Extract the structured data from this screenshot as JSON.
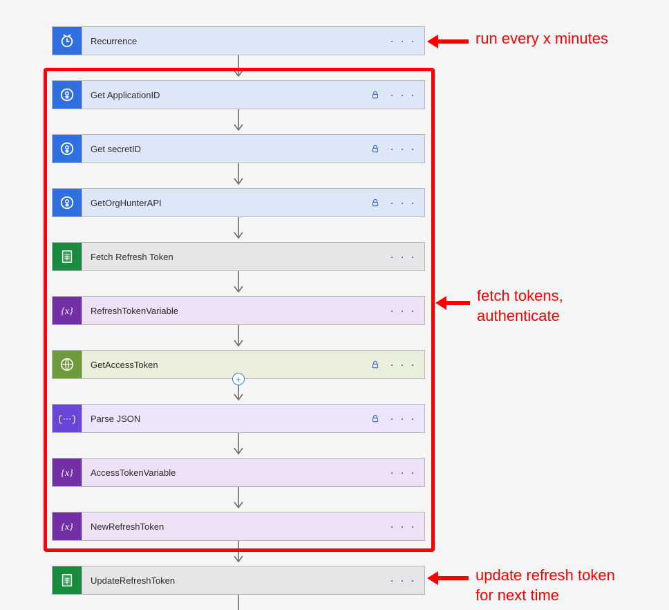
{
  "steps": [
    {
      "title": "Recurrence",
      "lock": false,
      "variant": "blue",
      "icon": "clock"
    },
    {
      "title": "Get ApplicationID",
      "lock": true,
      "variant": "blue",
      "icon": "keyvault"
    },
    {
      "title": "Get secretID",
      "lock": true,
      "variant": "blue",
      "icon": "keyvault"
    },
    {
      "title": "GetOrgHunterAPI",
      "lock": true,
      "variant": "blue",
      "icon": "keyvault"
    },
    {
      "title": "Fetch Refresh Token",
      "lock": false,
      "variant": "green-sheet",
      "icon": "sheet"
    },
    {
      "title": "RefreshTokenVariable",
      "lock": false,
      "variant": "purple-var",
      "icon": "var"
    },
    {
      "title": "GetAccessToken",
      "lock": true,
      "variant": "olive",
      "icon": "globe",
      "insert": true
    },
    {
      "title": "Parse JSON",
      "lock": true,
      "variant": "purple-parse",
      "icon": "parse"
    },
    {
      "title": "AccessTokenVariable",
      "lock": false,
      "variant": "purple-var",
      "icon": "var"
    },
    {
      "title": "NewRefreshToken",
      "lock": false,
      "variant": "purple-var",
      "icon": "var"
    },
    {
      "title": "UpdateRefreshToken",
      "lock": false,
      "variant": "green-sheet",
      "icon": "sheet"
    }
  ],
  "annotations": {
    "top": "run every x minutes",
    "middle_line1": "fetch tokens,",
    "middle_line2": "authenticate",
    "bottom_line1": "update refresh token",
    "bottom_line2": "for next time"
  },
  "insert_label": "+"
}
